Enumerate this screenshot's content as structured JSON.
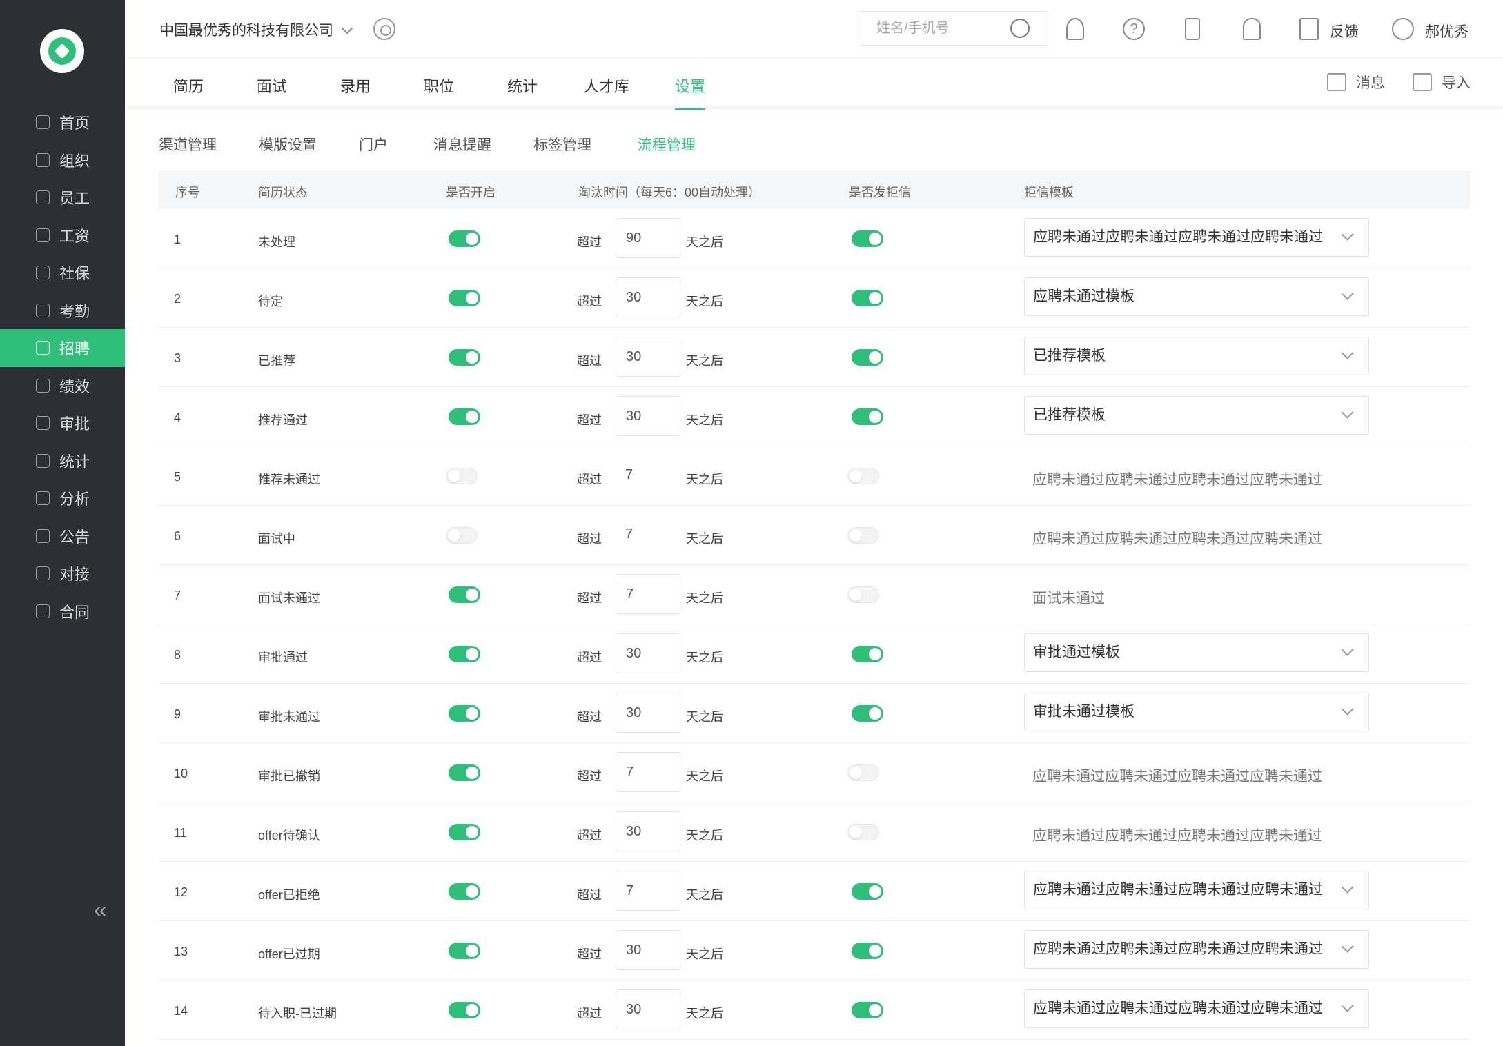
{
  "sidebar": {
    "items": [
      {
        "label": "首页",
        "icon": "home-icon",
        "active": false
      },
      {
        "label": "组织",
        "icon": "org-icon",
        "active": false
      },
      {
        "label": "员工",
        "icon": "employee-icon",
        "active": false
      },
      {
        "label": "工资",
        "icon": "salary-icon",
        "active": false
      },
      {
        "label": "社保",
        "icon": "shield-icon",
        "active": false
      },
      {
        "label": "考勤",
        "icon": "calendar-icon",
        "active": false
      },
      {
        "label": "招聘",
        "icon": "recruit-icon",
        "active": true
      },
      {
        "label": "绩效",
        "icon": "chart-line-icon",
        "active": false
      },
      {
        "label": "审批",
        "icon": "stamp-icon",
        "active": false
      },
      {
        "label": "统计",
        "icon": "bar-chart-icon",
        "active": false
      },
      {
        "label": "分析",
        "icon": "analysis-icon",
        "active": false
      },
      {
        "label": "公告",
        "icon": "notice-icon",
        "active": false
      },
      {
        "label": "对接",
        "icon": "link-icon",
        "active": false
      },
      {
        "label": "合同",
        "icon": "contract-icon",
        "active": false
      }
    ],
    "collapse_glyph": "«"
  },
  "header": {
    "company": "中国最优秀的科技有限公司",
    "search_placeholder": "姓名/手机号",
    "help_glyph": "?",
    "feedback": "反馈",
    "username": "郝优秀"
  },
  "tabs": [
    "简历",
    "面试",
    "录用",
    "职位",
    "统计",
    "人才库",
    "设置"
  ],
  "active_tab": "设置",
  "actions": {
    "messages": "消息",
    "import": "导入"
  },
  "subtabs": [
    "渠道管理",
    "模版设置",
    "门户",
    "消息提醒",
    "标签管理",
    "流程管理"
  ],
  "active_subtab": "流程管理",
  "columns": {
    "no": "序号",
    "status": "简历状态",
    "enabled": "是否开启",
    "timeout": "淘汰时间（每天6：00自动处理）",
    "send_reject": "是否发拒信",
    "template": "拒信模板"
  },
  "over_label": "超过",
  "after_label": "天之后",
  "rows": [
    {
      "no": "1",
      "status": "未处理",
      "enabled": true,
      "days": "90",
      "send": true,
      "template": "应聘未通过应聘未通过应聘未通过应聘未通过",
      "select": true
    },
    {
      "no": "2",
      "status": "待定",
      "enabled": true,
      "days": "30",
      "send": true,
      "template": "应聘未通过模板",
      "select": true
    },
    {
      "no": "3",
      "status": "已推荐",
      "enabled": true,
      "days": "30",
      "send": true,
      "template": "已推荐模板",
      "select": true
    },
    {
      "no": "4",
      "status": "推荐通过",
      "enabled": true,
      "days": "30",
      "send": true,
      "template": "已推荐模板",
      "select": true
    },
    {
      "no": "5",
      "status": "推荐未通过",
      "enabled": false,
      "days": "7",
      "send": false,
      "template": "应聘未通过应聘未通过应聘未通过应聘未通过",
      "select": false
    },
    {
      "no": "6",
      "status": "面试中",
      "enabled": false,
      "days": "7",
      "send": false,
      "template": "应聘未通过应聘未通过应聘未通过应聘未通过",
      "select": false
    },
    {
      "no": "7",
      "status": "面试未通过",
      "enabled": true,
      "days": "7",
      "send": false,
      "template": "面试未通过",
      "select": false
    },
    {
      "no": "8",
      "status": "审批通过",
      "enabled": true,
      "days": "30",
      "send": true,
      "template": "审批通过模板",
      "select": true
    },
    {
      "no": "9",
      "status": "审批未通过",
      "enabled": true,
      "days": "30",
      "send": true,
      "template": "审批未通过模板",
      "select": true
    },
    {
      "no": "10",
      "status": "审批已撤销",
      "enabled": true,
      "days": "7",
      "send": false,
      "template": "应聘未通过应聘未通过应聘未通过应聘未通过",
      "select": false
    },
    {
      "no": "11",
      "status": "offer待确认",
      "enabled": true,
      "days": "30",
      "send": false,
      "template": "应聘未通过应聘未通过应聘未通过应聘未通过",
      "select": false
    },
    {
      "no": "12",
      "status": "offer已拒绝",
      "enabled": true,
      "days": "7",
      "send": true,
      "template": "应聘未通过应聘未通过应聘未通过应聘未通过",
      "select": true
    },
    {
      "no": "13",
      "status": "offer已过期",
      "enabled": true,
      "days": "30",
      "send": true,
      "template": "应聘未通过应聘未通过应聘未通过应聘未通过",
      "select": true
    },
    {
      "no": "14",
      "status": "待入职-已过期",
      "enabled": true,
      "days": "30",
      "send": true,
      "template": "应聘未通过应聘未通过应聘未通过应聘未通过",
      "select": true
    }
  ],
  "colors": {
    "accent": "#2fbf7a",
    "sidebar_bg": "#2c2f33"
  }
}
